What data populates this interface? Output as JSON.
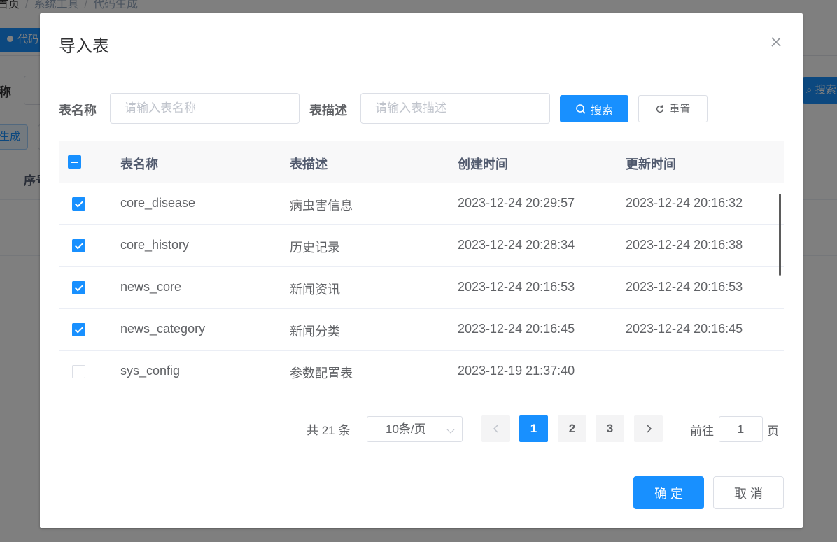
{
  "background": {
    "breadcrumb": [
      "首页",
      "系统工具",
      "代码生成"
    ],
    "tag_label": "代码",
    "search_label_partial": "称",
    "search_button_partial": "搜索",
    "generate_button_partial": "生成",
    "table_header_partial": "序号"
  },
  "dialog": {
    "title": "导入表",
    "form": {
      "table_name_label": "表名称",
      "table_name_placeholder": "请输入表名称",
      "table_desc_label": "表描述",
      "table_desc_placeholder": "请输入表描述",
      "search_button": "搜索",
      "reset_button": "重置"
    },
    "table": {
      "columns": [
        "表名称",
        "表描述",
        "创建时间",
        "更新时间"
      ],
      "rows": [
        {
          "checked": true,
          "name": "core_disease",
          "desc": "病虫害信息",
          "created": "2023-12-24 20:29:57",
          "updated": "2023-12-24 20:16:32"
        },
        {
          "checked": true,
          "name": "core_history",
          "desc": "历史记录",
          "created": "2023-12-24 20:28:34",
          "updated": "2023-12-24 20:16:38"
        },
        {
          "checked": true,
          "name": "news_core",
          "desc": "新闻资讯",
          "created": "2023-12-24 20:16:53",
          "updated": "2023-12-24 20:16:53"
        },
        {
          "checked": true,
          "name": "news_category",
          "desc": "新闻分类",
          "created": "2023-12-24 20:16:45",
          "updated": "2023-12-24 20:16:45"
        },
        {
          "checked": false,
          "name": "sys_config",
          "desc": "参数配置表",
          "created": "2023-12-19 21:37:40",
          "updated": ""
        }
      ]
    },
    "pagination": {
      "total_text": "共 21 条",
      "page_size": "10条/页",
      "pages": [
        "1",
        "2",
        "3"
      ],
      "current_page": "1",
      "goto_prefix": "前往",
      "goto_value": "1",
      "goto_suffix": "页"
    },
    "footer": {
      "confirm": "确 定",
      "cancel": "取 消"
    }
  },
  "colors": {
    "primary": "#1890ff",
    "overlay": "rgba(0,0,0,0.5)"
  }
}
